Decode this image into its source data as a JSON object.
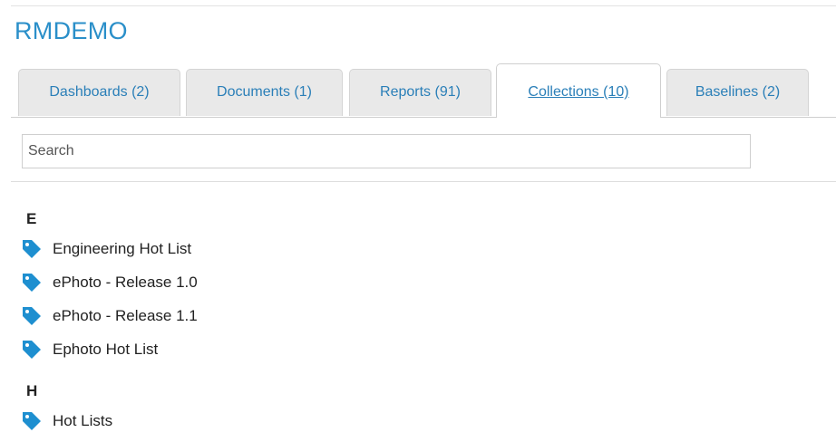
{
  "project": {
    "title": "RMDEMO"
  },
  "tabs": [
    {
      "label": "Dashboards (2)",
      "active": false
    },
    {
      "label": "Documents (1)",
      "active": false
    },
    {
      "label": "Reports (91)",
      "active": false
    },
    {
      "label": "Collections (10)",
      "active": true
    },
    {
      "label": "Baselines (2)",
      "active": false
    }
  ],
  "search": {
    "placeholder": "Search",
    "value": ""
  },
  "groups": [
    {
      "letter": "E",
      "items": [
        {
          "label": "Engineering Hot List",
          "icon": "tag-icon"
        },
        {
          "label": "ePhoto - Release 1.0",
          "icon": "tag-icon"
        },
        {
          "label": "ePhoto - Release 1.1",
          "icon": "tag-icon"
        },
        {
          "label": "Ephoto Hot List",
          "icon": "tag-icon"
        }
      ]
    },
    {
      "letter": "H",
      "items": [
        {
          "label": "Hot Lists",
          "icon": "tag-icon"
        }
      ]
    }
  ],
  "colors": {
    "accent": "#2a8fc9",
    "tag_icon": "#1e8fd0",
    "tab_bg": "#e9e9e9"
  }
}
